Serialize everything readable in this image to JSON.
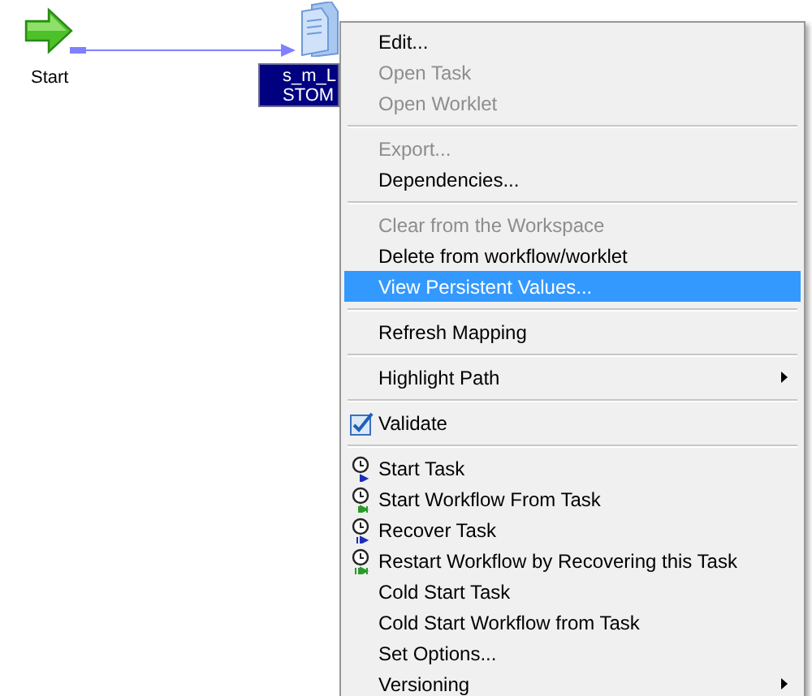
{
  "canvas": {
    "start_task": {
      "label": "Start"
    },
    "session_task": {
      "label_lines": [
        "s_m_L",
        "STOM"
      ],
      "selected": true
    }
  },
  "context_menu": {
    "items": [
      {
        "kind": "item",
        "label": "Edit...",
        "disabled": false,
        "selected": false
      },
      {
        "kind": "item",
        "label": "Open Task",
        "disabled": true,
        "selected": false
      },
      {
        "kind": "item",
        "label": "Open Worklet",
        "disabled": true,
        "selected": false
      },
      {
        "kind": "separator"
      },
      {
        "kind": "item",
        "label": "Export...",
        "disabled": true,
        "selected": false
      },
      {
        "kind": "item",
        "label": "Dependencies...",
        "disabled": false,
        "selected": false
      },
      {
        "kind": "separator"
      },
      {
        "kind": "item",
        "label": "Clear from the Workspace",
        "disabled": true,
        "selected": false
      },
      {
        "kind": "item",
        "label": "Delete from workflow/worklet",
        "disabled": false,
        "selected": false
      },
      {
        "kind": "item",
        "label": "View Persistent Values...",
        "disabled": false,
        "selected": true
      },
      {
        "kind": "separator"
      },
      {
        "kind": "item",
        "label": "Refresh Mapping",
        "disabled": false,
        "selected": false
      },
      {
        "kind": "separator"
      },
      {
        "kind": "item",
        "label": "Highlight Path",
        "disabled": false,
        "selected": false,
        "submenu": true
      },
      {
        "kind": "separator"
      },
      {
        "kind": "validate",
        "label": "Validate",
        "disabled": false,
        "selected": false
      },
      {
        "kind": "separator"
      },
      {
        "kind": "start",
        "label": "Start Task",
        "disabled": false,
        "selected": false
      },
      {
        "kind": "startworkflow",
        "label": "Start Workflow From Task",
        "disabled": false,
        "selected": false
      },
      {
        "kind": "recover",
        "label": "Recover Task",
        "disabled": false,
        "selected": false
      },
      {
        "kind": "restartworkflow",
        "label": "Restart Workflow by Recovering this Task",
        "disabled": false,
        "selected": false
      },
      {
        "kind": "item",
        "label": "Cold Start Task",
        "disabled": false,
        "selected": false
      },
      {
        "kind": "item",
        "label": "Cold Start Workflow from Task",
        "disabled": false,
        "selected": false
      },
      {
        "kind": "item",
        "label": "Set Options...",
        "disabled": false,
        "selected": false
      },
      {
        "kind": "item",
        "label": "Versioning",
        "disabled": false,
        "selected": false,
        "submenu": true
      }
    ]
  }
}
